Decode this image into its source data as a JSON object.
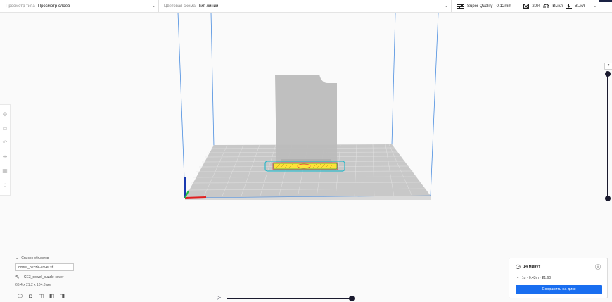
{
  "topbar": {
    "view_type_label": "Просмотр типа",
    "view_type_value": "Просмотр слоёв",
    "color_scheme_label": "Цветовая схема",
    "color_scheme_value": "Тип линии",
    "profile": "Super Quality - 0.12mm",
    "infill": "20%",
    "support": "Выкл",
    "adhesion": "Выкл"
  },
  "layer_slider": {
    "current_layer": "7"
  },
  "object_list": {
    "header": "Список объектов",
    "file": "dowel_puzzle-cover.stl",
    "object_name": "CE3_dowel_puzzle-cover",
    "dimensions": "66.4 x 21.2 x 104.8 мм"
  },
  "print_panel": {
    "time": "14 минут",
    "material": "1g · 0.43m · ₽1.60",
    "save_button": "Сохранить на диск"
  },
  "colors": {
    "accent": "#196ef0",
    "dark": "#1a1a2e",
    "build_volume": "#4a8de0"
  }
}
